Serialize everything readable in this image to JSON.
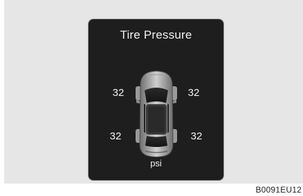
{
  "panel": {
    "title": "Tire Pressure",
    "unit": "psi",
    "tires": {
      "front_left": "32",
      "front_right": "32",
      "rear_left": "32",
      "rear_right": "32"
    }
  },
  "figure_code": "B0091EU12",
  "colors": {
    "panel_background": "#1e1e1e",
    "panel_text": "#f2f2f2",
    "frame_background": "#e6e6e6"
  }
}
